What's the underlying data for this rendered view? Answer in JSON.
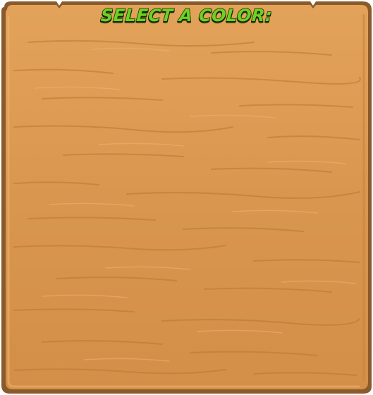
{
  "panel": {
    "title": "Select a color:",
    "wood_color": "#d9964e",
    "wood_border_color": "#8a5a2b",
    "title_color": "#6fd11f"
  }
}
